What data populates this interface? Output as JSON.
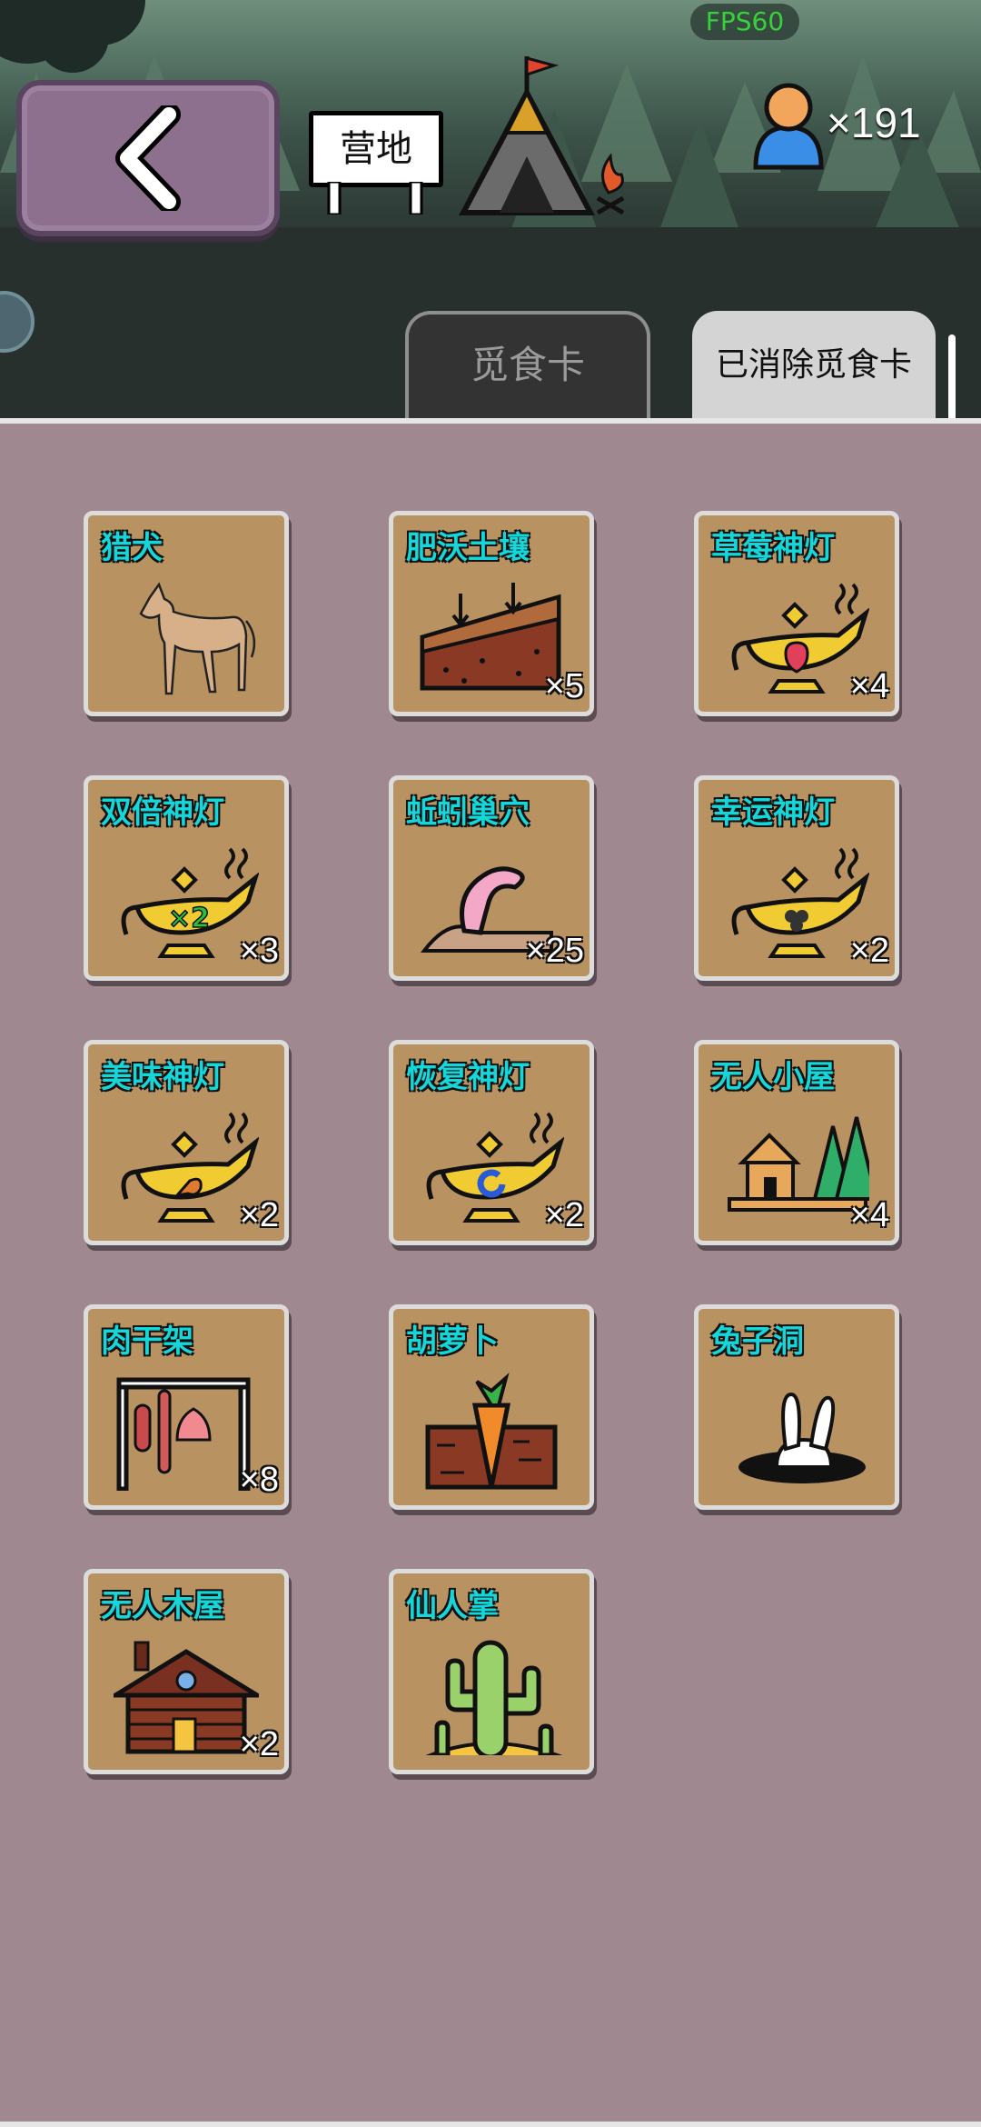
{
  "header": {
    "fps": "FPS60",
    "camp_label": "营地",
    "population": "×191"
  },
  "tabs": [
    {
      "label": "觅食卡",
      "active": false
    },
    {
      "label": "已消除觅食卡",
      "active": true
    }
  ],
  "cards": [
    {
      "name": "猎犬",
      "count": "",
      "icon": "dog-icon"
    },
    {
      "name": "肥沃土壤",
      "count": "×5",
      "icon": "soil-icon"
    },
    {
      "name": "草莓神灯",
      "count": "×4",
      "icon": "strawberry-lamp-icon"
    },
    {
      "name": "双倍神灯",
      "count": "×3",
      "icon": "double-lamp-icon",
      "lamp_mark": "×2"
    },
    {
      "name": "蚯蚓巢穴",
      "count": "×25",
      "icon": "earthworm-icon"
    },
    {
      "name": "幸运神灯",
      "count": "×2",
      "icon": "clover-lamp-icon"
    },
    {
      "name": "美味神灯",
      "count": "×2",
      "icon": "drumstick-lamp-icon"
    },
    {
      "name": "恢复神灯",
      "count": "×2",
      "icon": "restore-lamp-icon"
    },
    {
      "name": "无人小屋",
      "count": "×4",
      "icon": "hut-icon"
    },
    {
      "name": "肉干架",
      "count": "×8",
      "icon": "meat-rack-icon"
    },
    {
      "name": "胡萝卜",
      "count": "",
      "icon": "carrot-icon"
    },
    {
      "name": "兔子洞",
      "count": "",
      "icon": "rabbit-hole-icon"
    },
    {
      "name": "无人木屋",
      "count": "×2",
      "icon": "log-cabin-icon"
    },
    {
      "name": "仙人掌",
      "count": "",
      "icon": "cactus-icon"
    }
  ]
}
